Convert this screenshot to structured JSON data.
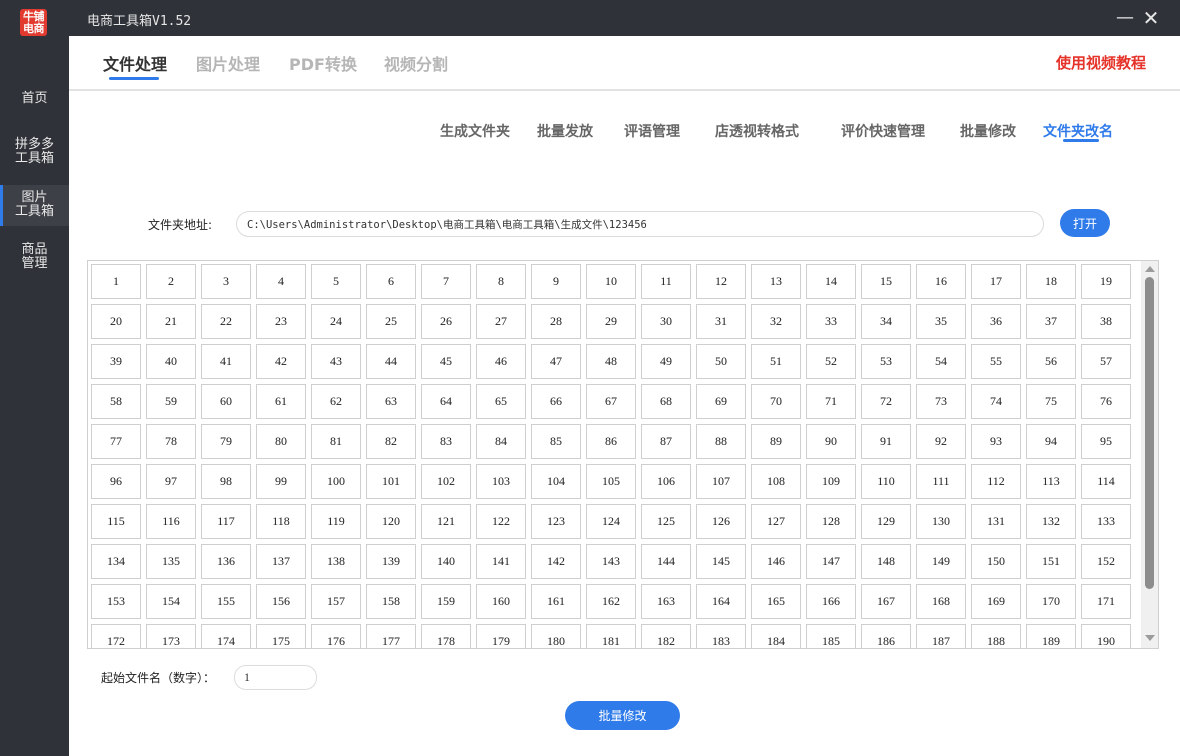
{
  "app": {
    "title": "电商工具箱V1.52",
    "logo_line1": "牛铺",
    "logo_line2": "电商",
    "minimize_symbol": "—",
    "close_symbol": "✕"
  },
  "sidebar": {
    "items": [
      {
        "line1": "首页",
        "line2": ""
      },
      {
        "line1": "拼多多",
        "line2": "工具箱"
      },
      {
        "line1": "图片",
        "line2": "工具箱"
      },
      {
        "line1": "商品",
        "line2": "管理"
      }
    ]
  },
  "tabs": [
    "文件处理",
    "图片处理",
    "PDF转换",
    "视频分割"
  ],
  "tutorial_link": "使用视频教程",
  "subtabs": [
    "生成文件夹",
    "批量发放",
    "评语管理",
    "店透视转格式",
    "评价快速管理",
    "批量修改",
    "文件夹改名"
  ],
  "form": {
    "path_label": "文件夹地址:",
    "path_value": "C:\\Users\\Administrator\\Desktop\\电商工具箱\\电商工具箱\\生成文件\\123456",
    "open_button": "打开",
    "start_label": "起始文件名（数字）：",
    "start_value": "1",
    "batch_button": "批量修改"
  },
  "grid": {
    "first": 1,
    "last": 190,
    "columns": 19
  },
  "colors": {
    "accent": "#2f7bea",
    "sidebar_bg": "#2f3238",
    "tutorial_red": "#e5332a",
    "logo_red": "#e23a2f"
  }
}
